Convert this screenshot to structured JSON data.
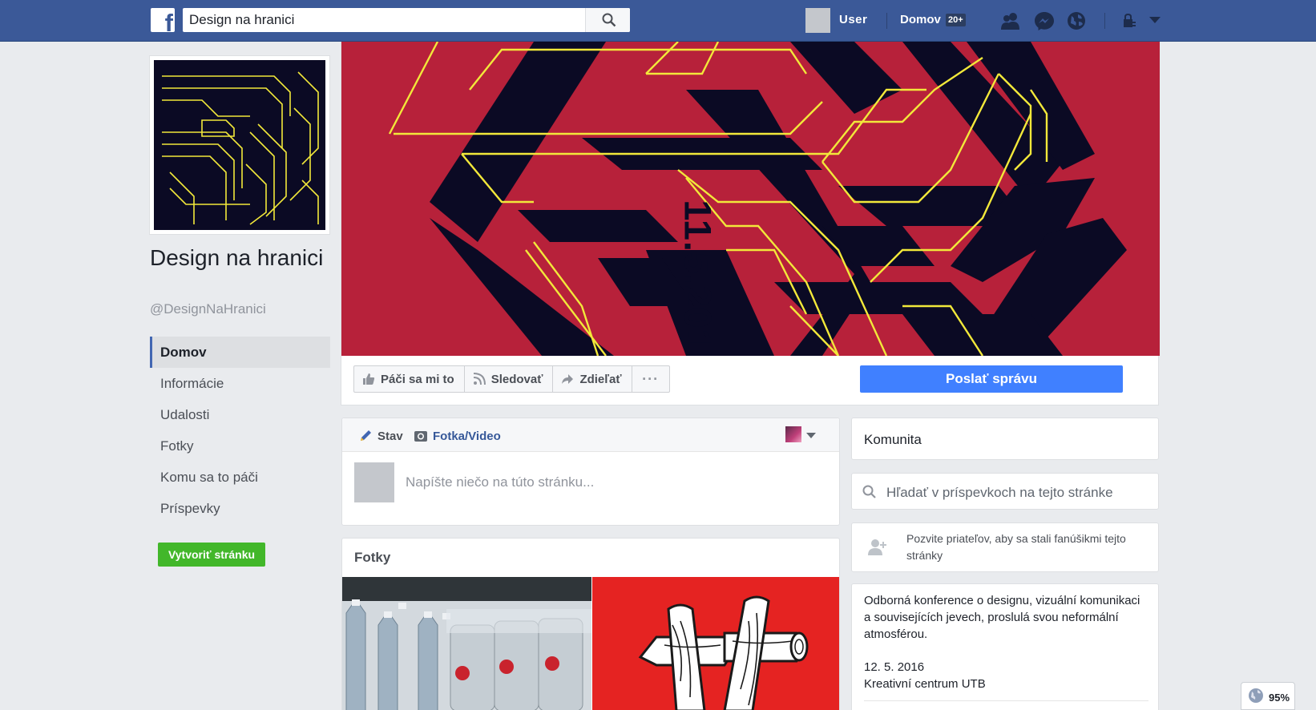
{
  "topbar": {
    "search_value": "Design na hranici",
    "user_label": "User",
    "home_label": "Domov",
    "home_badge": "20+"
  },
  "page": {
    "name": "Design na hranici",
    "handle": "@DesignNaHranici"
  },
  "nav": {
    "items": [
      {
        "label": "Domov"
      },
      {
        "label": "Informácie"
      },
      {
        "label": "Udalosti"
      },
      {
        "label": "Fotky"
      },
      {
        "label": "Komu sa to páči"
      },
      {
        "label": "Príspevky"
      }
    ],
    "create_page": "Vytvoriť stránku"
  },
  "cover": {
    "date_text": "11.5.2017"
  },
  "actions": {
    "like": "Páči sa mi to",
    "follow": "Sledovať",
    "share": "Zdieľať",
    "more": "···",
    "message": "Poslať správu"
  },
  "composer": {
    "status_tab": "Stav",
    "photo_tab": "Fotka/Video",
    "placeholder": "Napíšte niečo na túto stránku..."
  },
  "photos": {
    "title": "Fotky"
  },
  "sidebar": {
    "community": "Komunita",
    "search_posts": "Hľadať v príspevkoch na tejto stránke",
    "invite": "Pozvite priateľov, aby sa stali fanúšikmi tejto stránky",
    "about": "Odborná konference o designu, vizuální komunikaci a souvisejících jevech, proslulá svou neformální atmosférou.",
    "date": "12. 5. 2016",
    "place": "Kreativní centrum UTB"
  },
  "zoom": {
    "level": "95%"
  },
  "colors": {
    "topbar": "#3b5998",
    "cover_red": "#b7213a",
    "cover_navy": "#0b0a24",
    "cover_yellow": "#f2e83a",
    "message_button": "#4080ff",
    "create_button": "#42b72a"
  }
}
